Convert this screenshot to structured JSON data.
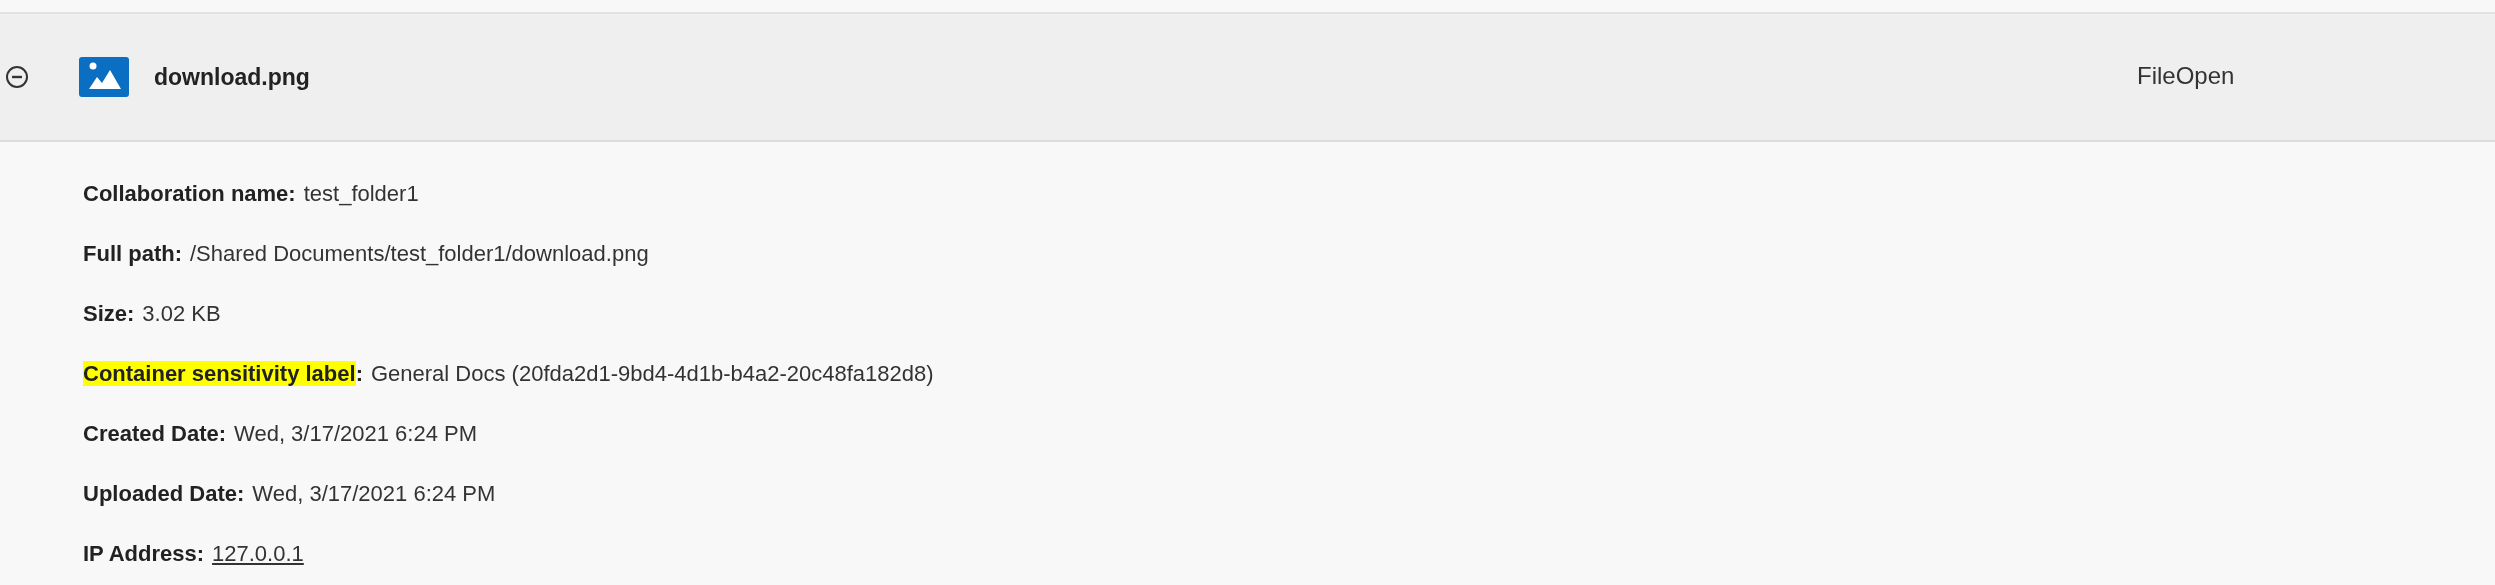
{
  "activity": {
    "expanded": true,
    "file_name": "download.png",
    "operation": "FileOpen",
    "details": [
      {
        "label": "Collaboration name:",
        "value": "test_folder1",
        "kind": "text",
        "highlighted": false
      },
      {
        "label": "Full path:",
        "value": "/Shared Documents/test_folder1/download.png",
        "kind": "text",
        "highlighted": false
      },
      {
        "label": "Size:",
        "value": "3.02 KB",
        "kind": "text",
        "highlighted": false
      },
      {
        "label": "Container sensitivity label:",
        "value": "General Docs (20fda2d1-9bd4-4d1b-b4a2-20c48fa182d8)",
        "kind": "text",
        "highlighted": true
      },
      {
        "label": "Created Date:",
        "value": "Wed, 3/17/2021 6:24 PM",
        "kind": "text",
        "highlighted": false
      },
      {
        "label": "Uploaded Date:",
        "value": "Wed, 3/17/2021 6:24 PM",
        "kind": "text",
        "highlighted": false
      },
      {
        "label": "IP Address:",
        "value": "127.0.0.1",
        "kind": "link",
        "highlighted": false
      }
    ]
  }
}
